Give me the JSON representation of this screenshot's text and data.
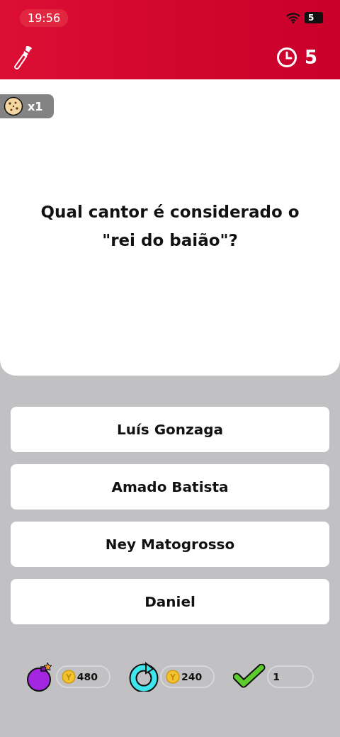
{
  "status_bar": {
    "time": "19:56",
    "battery": "5"
  },
  "header": {
    "timer": "5"
  },
  "badge": {
    "count": "x1"
  },
  "question": "Qual cantor é considerado o \"rei do baião\"?",
  "answers": [
    {
      "label": "Luís Gonzaga"
    },
    {
      "label": "Amado Batista"
    },
    {
      "label": "Ney Matogrosso"
    },
    {
      "label": "Daniel"
    }
  ],
  "powerups": [
    {
      "kind": "bomb",
      "price": "480"
    },
    {
      "kind": "refresh",
      "price": "240"
    },
    {
      "kind": "check",
      "price": "1"
    }
  ]
}
